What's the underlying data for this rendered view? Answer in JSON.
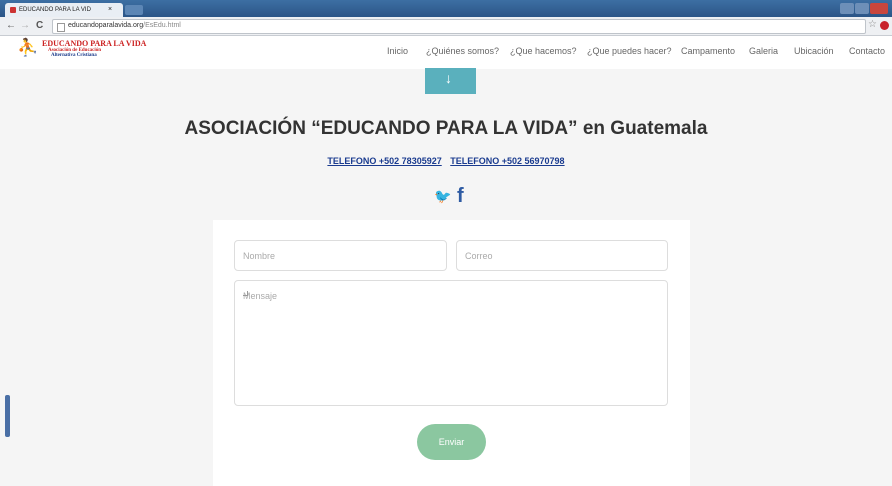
{
  "browser": {
    "tab_title": "EDUCANDO PARA LA VID",
    "tab_close": "×",
    "url_domain": "educandoparalavida.org",
    "url_path": "/EsEdu.html",
    "back": "←",
    "forward": "→",
    "reload": "C",
    "bookmark_star": "☆"
  },
  "site": {
    "logo": {
      "line1": "EDUCANDO PARA LA VIDA",
      "line2": "Asociación de Educación",
      "line3": "Alternativa Cristiana"
    },
    "nav": [
      {
        "label": "Inicio"
      },
      {
        "label": "¿Quiénes somos?"
      },
      {
        "label": "¿Que hacemos?"
      },
      {
        "label": "¿Que puedes hacer?"
      },
      {
        "label": "Campamento"
      },
      {
        "label": "Galeria"
      },
      {
        "label": "Ubicación"
      },
      {
        "label": "Contacto"
      }
    ],
    "scroll_arrow": "↓"
  },
  "main": {
    "heading": "ASOCIACIÓN “EDUCANDO PARA LA VIDA” en Guatemala",
    "phone1": "TELEFONO +502 78305927",
    "phone2": "TELEFONO +502 56970798",
    "social": {
      "twitter": "🐦",
      "facebook": "f"
    }
  },
  "form": {
    "name_placeholder": "Nombre",
    "email_placeholder": "Correo",
    "message_placeholder": "Mensaje",
    "send_label": "Enviar"
  },
  "colors": {
    "accent_teal": "#5ab0bd",
    "send_green": "#8bc7a0",
    "link_blue": "#1a3b8f",
    "brand_red": "#c22"
  }
}
